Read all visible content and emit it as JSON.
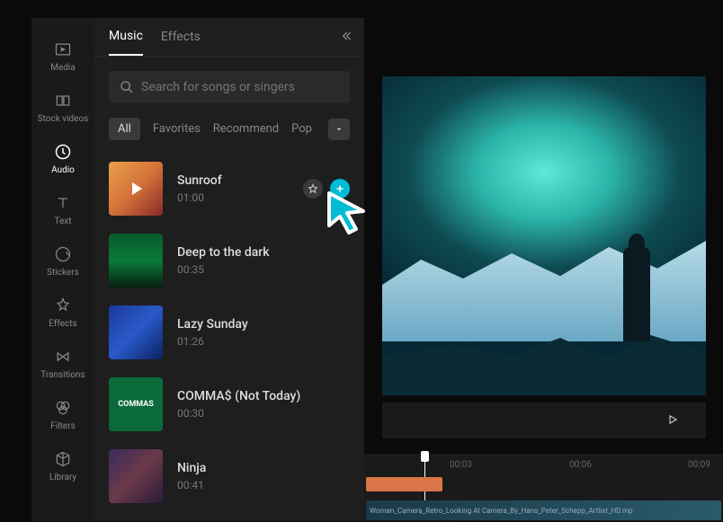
{
  "sidebar": {
    "items": [
      {
        "label": "Media"
      },
      {
        "label": "Stock videos"
      },
      {
        "label": "Audio"
      },
      {
        "label": "Text"
      },
      {
        "label": "Stickers"
      },
      {
        "label": "Effects"
      },
      {
        "label": "Transitions"
      },
      {
        "label": "Filters"
      },
      {
        "label": "Library"
      }
    ]
  },
  "tabs": {
    "music": "Music",
    "effects": "Effects"
  },
  "search": {
    "placeholder": "Search for songs or singers"
  },
  "filters": {
    "all": "All",
    "favorites": "Favorites",
    "recommend": "Recommend",
    "pop": "Pop"
  },
  "songs": [
    {
      "title": "Sunroof",
      "duration": "01:00"
    },
    {
      "title": "Deep to the dark",
      "duration": "00:35"
    },
    {
      "title": "Lazy Sunday",
      "duration": "01:26"
    },
    {
      "title": "COMMA$ (Not Today)",
      "duration": "00:30"
    },
    {
      "title": "Ninja",
      "duration": "00:41"
    }
  ],
  "timeline": {
    "marks": [
      "00:03",
      "00:06",
      "00:09"
    ],
    "clip_label": "Woman_Camera_Retro_Looking At Camera_By_Hans_Peter_Schepp_Artlist_HD.mp"
  }
}
